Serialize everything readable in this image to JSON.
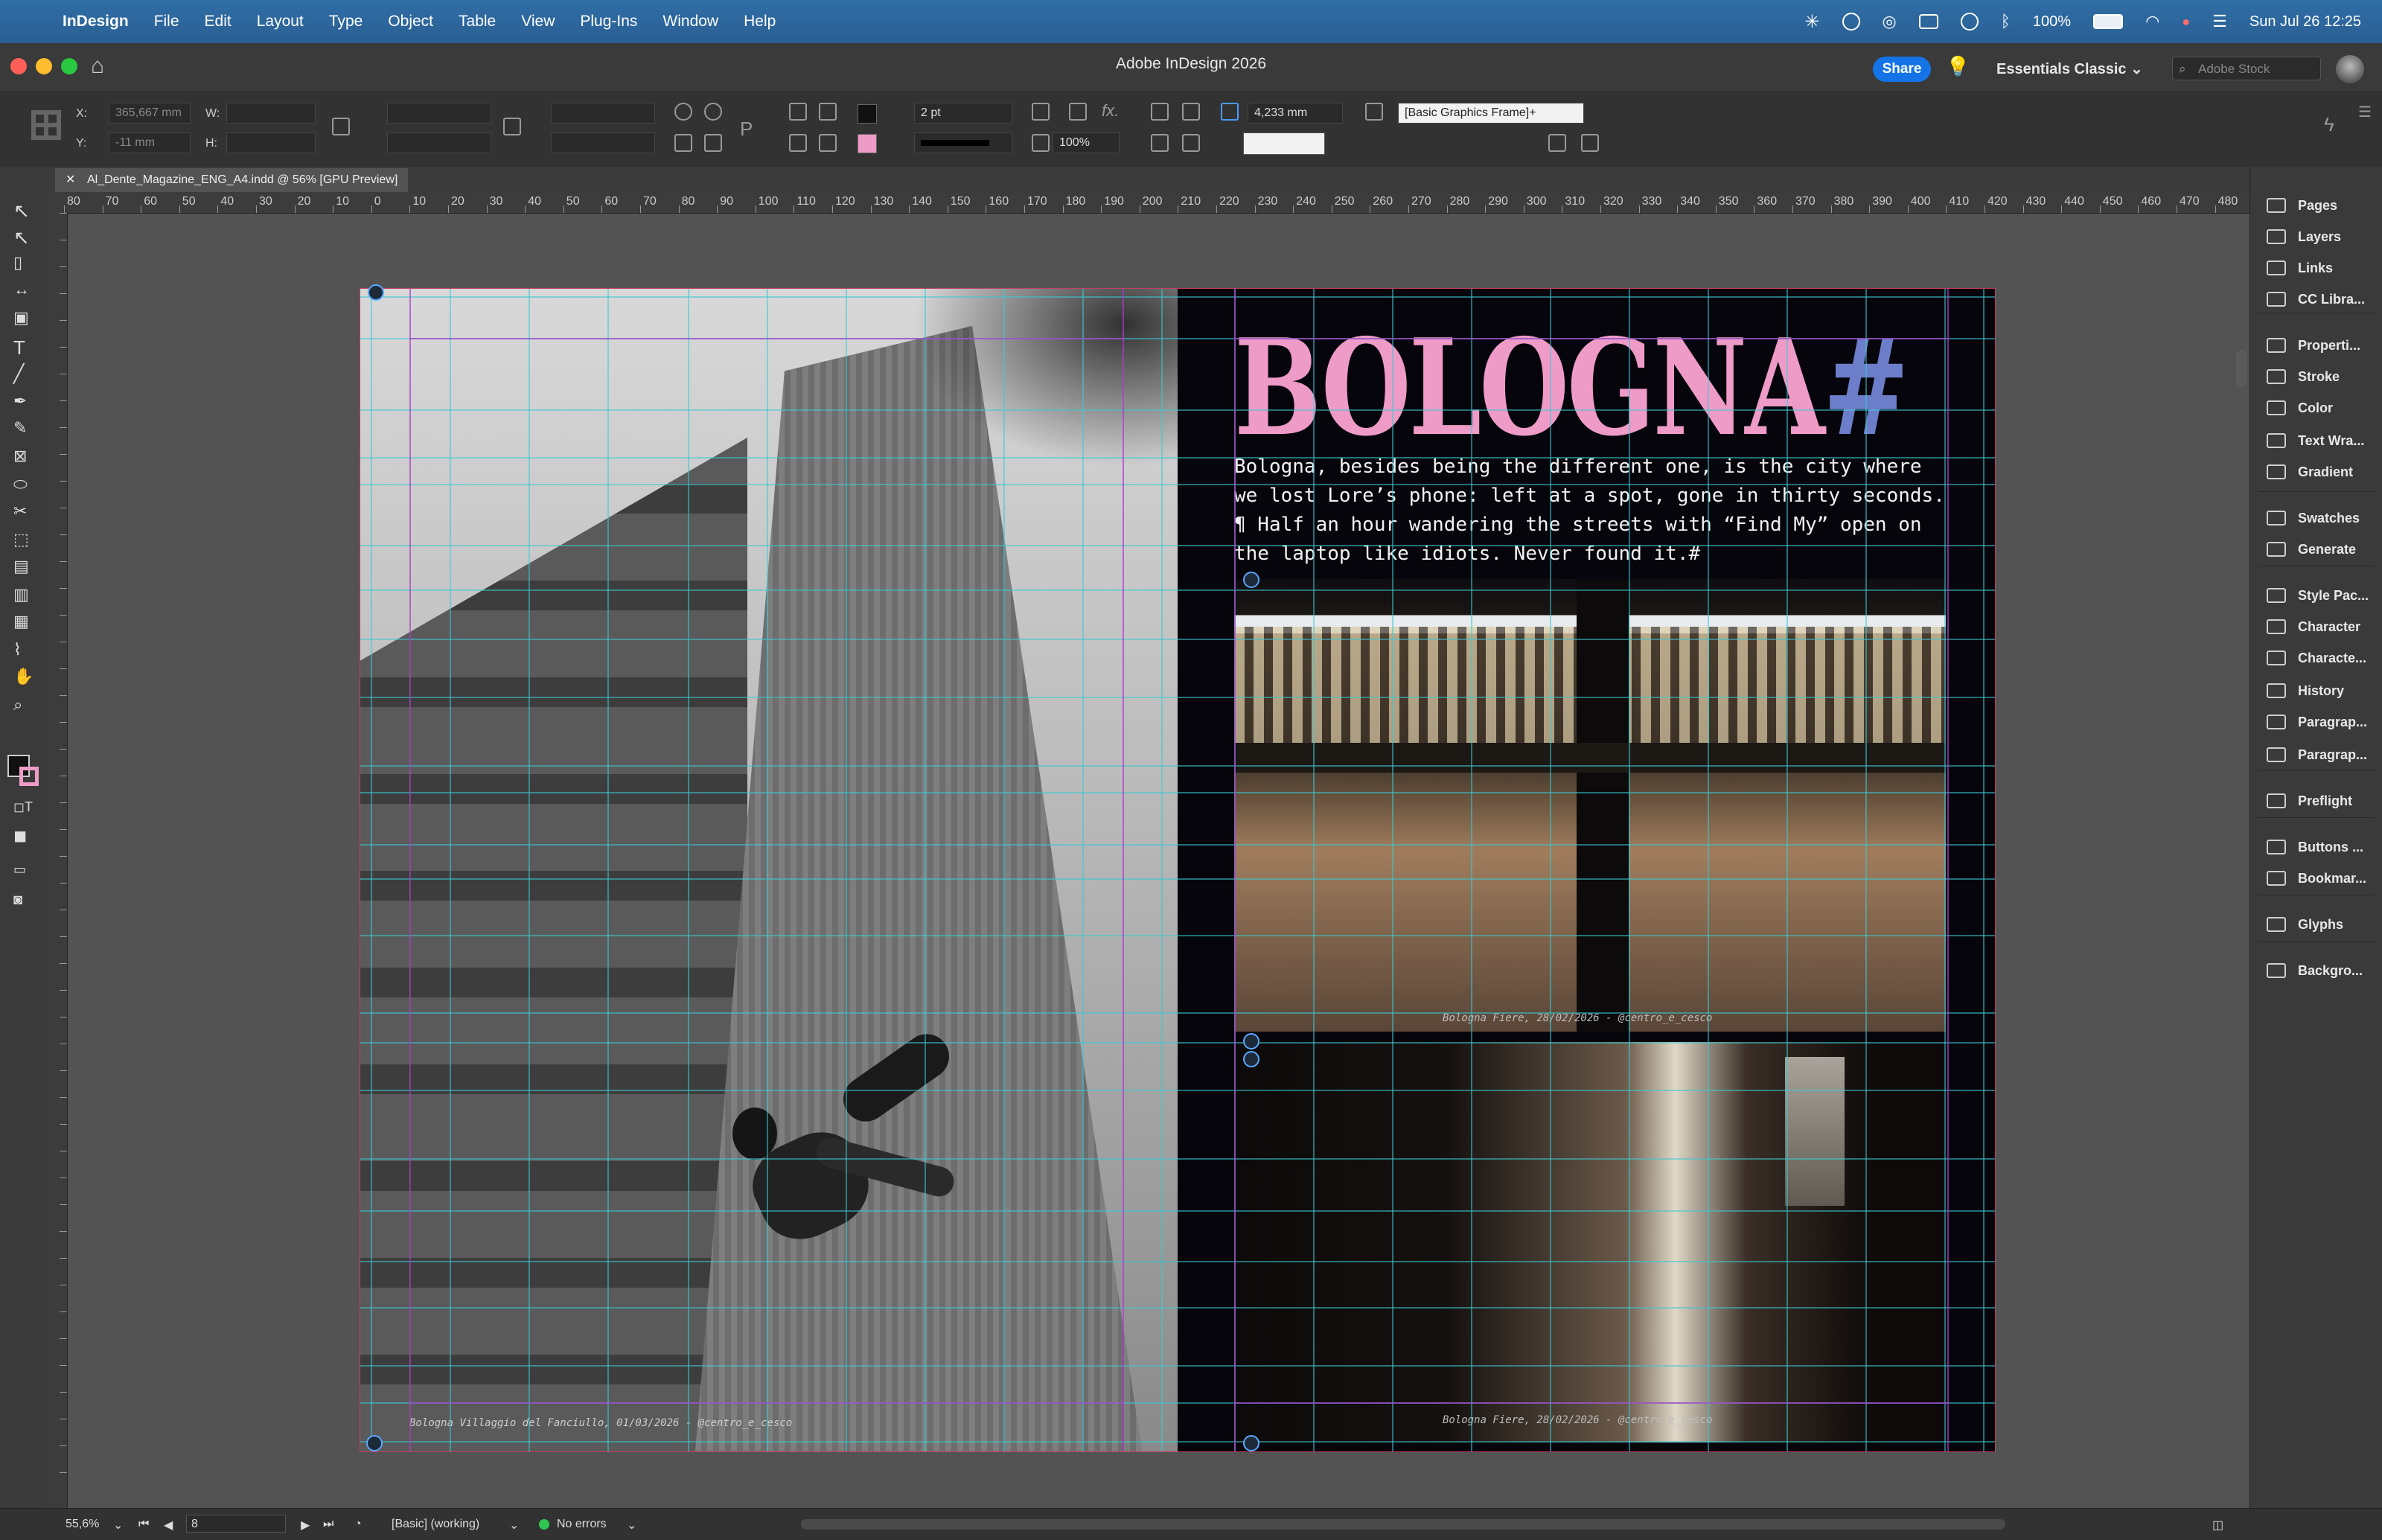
{
  "menubar": {
    "app_name": "InDesign",
    "items": [
      "File",
      "Edit",
      "Layout",
      "Type",
      "Object",
      "Table",
      "View",
      "Plug-Ins",
      "Window",
      "Help"
    ],
    "battery": "100%",
    "clock": "Sun Jul 26  12:25"
  },
  "titlebar": {
    "title": "Adobe InDesign 2026",
    "share_label": "Share",
    "workspace": "Essentials Classic",
    "stock_placeholder": "Adobe Stock"
  },
  "control": {
    "x_label": "X:",
    "x_value": "365,667 mm",
    "y_label": "Y:",
    "y_value": "-11 mm",
    "w_label": "W:",
    "h_label": "H:",
    "stroke_weight": "2 pt",
    "opacity": "100%",
    "dimension": "4,233 mm",
    "object_style": "[Basic Graphics Frame]+"
  },
  "document_tab": "Al_Dente_Magazine_ENG_A4.indd @ 56% [GPU Preview]",
  "ruler": [
    "80",
    "70",
    "60",
    "50",
    "40",
    "30",
    "20",
    "10",
    "0",
    "10",
    "20",
    "30",
    "40",
    "50",
    "60",
    "70",
    "80",
    "90",
    "100",
    "110",
    "120",
    "130",
    "140",
    "150",
    "160",
    "170",
    "180",
    "190",
    "200",
    "210",
    "220",
    "230",
    "240",
    "250",
    "260",
    "270",
    "280",
    "290",
    "300",
    "310",
    "320",
    "330",
    "340",
    "350",
    "360",
    "370",
    "380",
    "390",
    "400",
    "410",
    "420",
    "430",
    "440",
    "450",
    "460",
    "470",
    "480"
  ],
  "panels": [
    "Pages",
    "Layers",
    "Links",
    "CC Libra...",
    "Properti...",
    "Stroke",
    "Color",
    "Text Wra...",
    "Gradient",
    "Swatches",
    "Generate",
    "Style Pac...",
    "Character",
    "Characte...",
    "History",
    "Paragrap...",
    "Paragrap...",
    "Preflight",
    "Buttons ...",
    "Bookmar...",
    "Glyphs",
    "Backgro..."
  ],
  "spread": {
    "headline": "BOLOGNA",
    "headline_mark": "#",
    "body": "Bologna, besides being the different one, is the city where we lost Lore’s phone: left at a spot, gone in thirty seconds. ¶ Half an hour wandering the streets with “Find My” open on the laptop like idiots. Never found it.#",
    "caption_left": "Bologna Villaggio del Fanciullo, 01/03/2026 - @centro_e_cesco",
    "caption_fiere_1": "Bologna Fiere, 28/02/2026 - @centro_e_cesco",
    "caption_fiere_2": "Bologna Fiere, 28/02/2026 - @centro_e_cesco",
    "colors": {
      "headline": "#ef9bc7",
      "hash": "#6c7ec9",
      "page_bg": "#07050c"
    }
  },
  "status": {
    "zoom": "55,6%",
    "page": "8",
    "preflight_profile": "[Basic] (working)",
    "errors": "No errors"
  }
}
